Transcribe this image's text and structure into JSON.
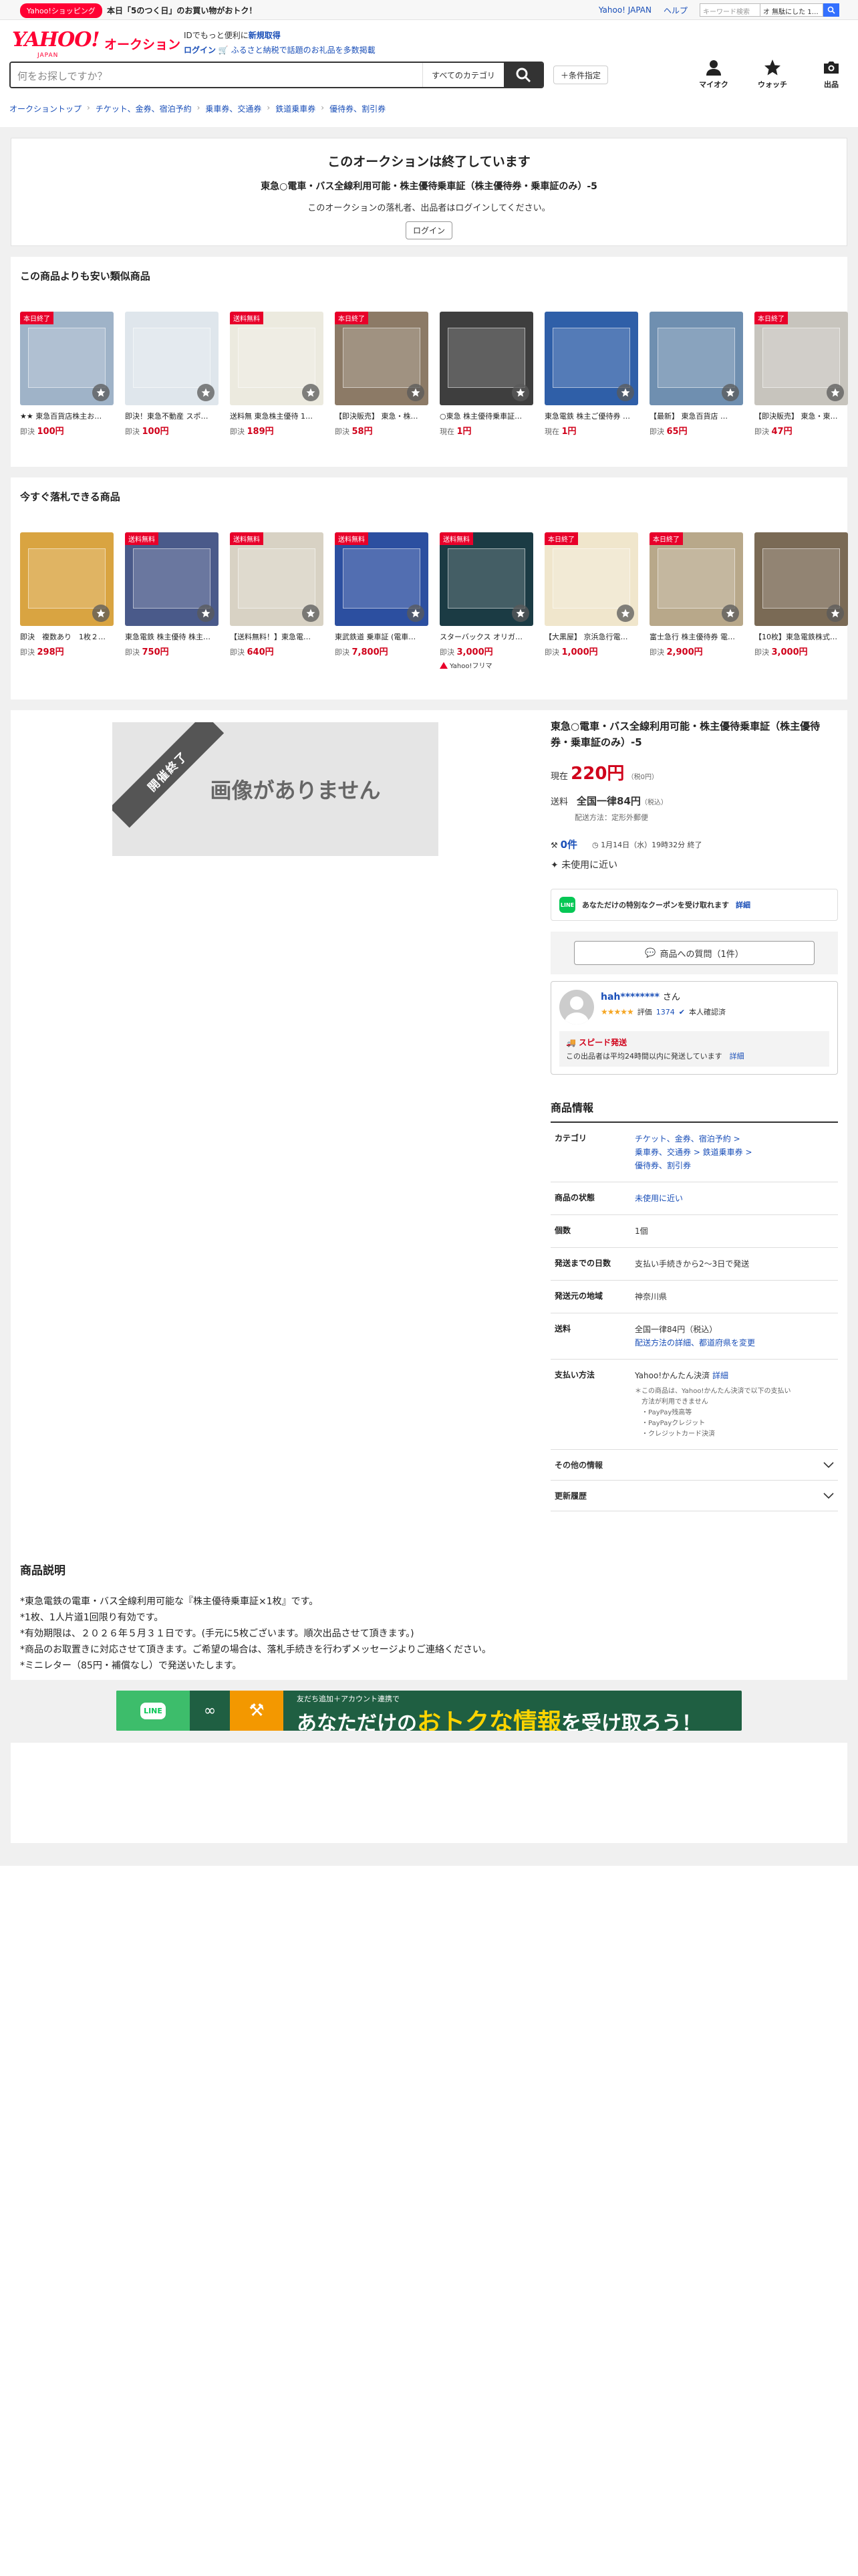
{
  "promo": {
    "tag": "Yahoo!ショッピング",
    "text": "本日「5のつく日」のお買い物がおトク！",
    "links": [
      "Yahoo! JAPAN",
      "ヘルプ"
    ],
    "mini_search_placeholder": "キーワード検索",
    "mini_search_select": "オ 無駄にした 1…"
  },
  "header": {
    "logo": "YAHOO!",
    "logo_sub": "JAPAN",
    "service": "オークション",
    "notice1_prefix": "IDでもっと便利に",
    "notice1_link": "新規取得",
    "notice2_login": "ログイン",
    "notice2_text": "ふるさと納税で話題のお礼品を多数掲載",
    "search_placeholder": "何をお探しですか？",
    "category": "すべてのカテゴリ",
    "cond_button": "＋条件指定",
    "icons": [
      {
        "label": "マイオク",
        "icon": "person-icon"
      },
      {
        "label": "ウォッチ",
        "icon": "star-icon"
      },
      {
        "label": "出品",
        "icon": "camera-icon"
      }
    ]
  },
  "breadcrumb": [
    "オークショントップ",
    "チケット、金券、宿泊予約",
    "乗車券、交通券",
    "鉄道乗車券",
    "優待券、割引券"
  ],
  "ended": {
    "title": "このオークションは終了しています",
    "item": "東急○電車・バス全線利用可能・株主優待乗車証（株主優待券・乗車証のみ）-5",
    "message": "このオークションの落札者、出品者はログインしてください。",
    "login": "ログイン"
  },
  "similar": {
    "title": "この商品よりも安い類似商品",
    "items": [
      {
        "badge": "本日終了",
        "title": "★★ 東急百貨店株主お…",
        "price_label": "即決",
        "price": "100円",
        "color": "#9fb3c8"
      },
      {
        "badge": "",
        "title": "即決！東急不動産 スポ…",
        "price_label": "即決",
        "price": "100円",
        "color": "#dfe6ec"
      },
      {
        "badge": "送料無料",
        "title": "送料無 東急株主優待 1…",
        "price_label": "即決",
        "price": "189円",
        "color": "#eceadf"
      },
      {
        "badge": "本日終了",
        "title": "【即決販売】 東急・株…",
        "price_label": "即決",
        "price": "58円",
        "color": "#8c7a66"
      },
      {
        "badge": "",
        "title": "○東急 株主優待乗車証…",
        "price_label": "現在",
        "price": "1円",
        "color": "#3e3e3e"
      },
      {
        "badge": "",
        "title": "東急電鉄 株主ご優待券 …",
        "price_label": "現在",
        "price": "1円",
        "color": "#2f5fa8"
      },
      {
        "badge": "",
        "title": "【最新】 東急百貨店 …",
        "price_label": "即決",
        "price": "65円",
        "color": "#6f8fb0"
      },
      {
        "badge": "本日終了",
        "title": "【即決販売】 東急・東…",
        "price_label": "即決",
        "price": "47円",
        "color": "#c7c4bd"
      }
    ]
  },
  "buynow": {
    "title": "今すぐ落札できる商品",
    "items": [
      {
        "badge": "",
        "title": "即決　複数あり　1枚２…",
        "price_label": "即決",
        "price": "298円",
        "color": "#d9a441",
        "tag": ""
      },
      {
        "badge": "送料無料",
        "title": "東急電鉄 株主優待 株主…",
        "price_label": "即決",
        "price": "750円",
        "color": "#4a5a8a",
        "tag": ""
      },
      {
        "badge": "送料無料",
        "title": "【送料無料！】東急電…",
        "price_label": "即決",
        "price": "640円",
        "color": "#d8d2c4",
        "tag": ""
      },
      {
        "badge": "送料無料",
        "title": "東武鉄道 乗車証 (電車…",
        "price_label": "即決",
        "price": "7,800円",
        "color": "#2c4fa0",
        "tag": ""
      },
      {
        "badge": "送料無料",
        "title": "スターバックス オリガ…",
        "price_label": "即決",
        "price": "3,000円",
        "color": "#1b3b44",
        "tag": "Yahoo!フリマ"
      },
      {
        "badge": "本日終了",
        "title": "【大黒屋】 京浜急行電…",
        "price_label": "即決",
        "price": "1,000円",
        "color": "#f0e6cc",
        "tag": ""
      },
      {
        "badge": "本日終了",
        "title": "富士急行 株主優待券 電…",
        "price_label": "即決",
        "price": "2,900円",
        "color": "#b8a88a",
        "tag": ""
      },
      {
        "badge": "",
        "title": "【10枚】東急電鉄株式…",
        "price_label": "即決",
        "price": "3,000円",
        "color": "#7a6a55",
        "tag": ""
      }
    ]
  },
  "main": {
    "no_image": "画像がありません",
    "ribbon": "開催終了",
    "title": "東急○電車・バス全線利用可能・株主優待乗車証（株主優待券・乗車証のみ）-5",
    "price_label": "現在",
    "price": "220円",
    "price_tax": "（税0円）",
    "ship_label": "送料",
    "ship_value": "全国一律84円",
    "ship_tax": "（税込）",
    "ship_method": "配送方法：定形外郵便",
    "bids": "0件",
    "end_time": "1月14日（水）19時32分 終了",
    "condition": "未使用に近い",
    "coupon_text": "あなただけの特別なクーポンを受け取れます",
    "coupon_link": "詳細",
    "question_button": "商品への質問（1件）",
    "seller": {
      "name": "hah********",
      "suffix": "さん",
      "rating_label": "評価",
      "rating": "1374",
      "verified": "本人確認済",
      "speed_title": "スピード発送",
      "speed_desc": "この出品者は平均24時間以内に発送しています",
      "speed_link": "詳細"
    },
    "info_title": "商品情報",
    "info": {
      "category_label": "カテゴリ",
      "category_lines": [
        "チケット、金券、宿泊予約 >",
        "乗車券、交通券 > 鉄道乗車券 >",
        "優待券、割引券"
      ],
      "state_label": "商品の状態",
      "state_value": "未使用に近い",
      "qty_label": "個数",
      "qty_value": "1個",
      "days_label": "発送までの日数",
      "days_value": "支払い手続きから2〜3日で発送",
      "region_label": "発送元の地域",
      "region_value": "神奈川県",
      "fee_label": "送料",
      "fee_value": "全国一律84円（税込）",
      "fee_link": "配送方法の詳細、都道府県を変更",
      "pay_label": "支払い方法",
      "pay_value": "Yahoo!かんたん決済",
      "pay_link": "詳細",
      "pay_note": [
        "＊この商品は、Yahoo!かんたん決済で以下の支払い",
        "方法が利用できません",
        "・PayPay残高等",
        "・PayPayクレジット",
        "・クレジットカード決済"
      ],
      "other_label": "その他の情報",
      "history_label": "更新履歴"
    },
    "desc_title": "商品説明",
    "desc_lines": [
      "*東急電鉄の電車・バス全線利用可能な『株主優待乗車証×1枚』です。",
      "*1枚、1人片道1回限り有効です。",
      "*有効期限は、２０２６年５月３１日です。(手元に5枚ございます。順次出品させて頂きます。)",
      "*商品のお取置きに対応させて頂きます。ご希望の場合は、落札手続きを行わずメッセージよりご連絡ください。",
      "*ミニレター（85円・補償なし）で発送いたします。"
    ]
  },
  "banner": {
    "sub": "友だち追加＋アカウント連携で",
    "text_a": "あなただけの",
    "text_b": "おトクな情報",
    "text_c": "を受け取ろう！"
  }
}
